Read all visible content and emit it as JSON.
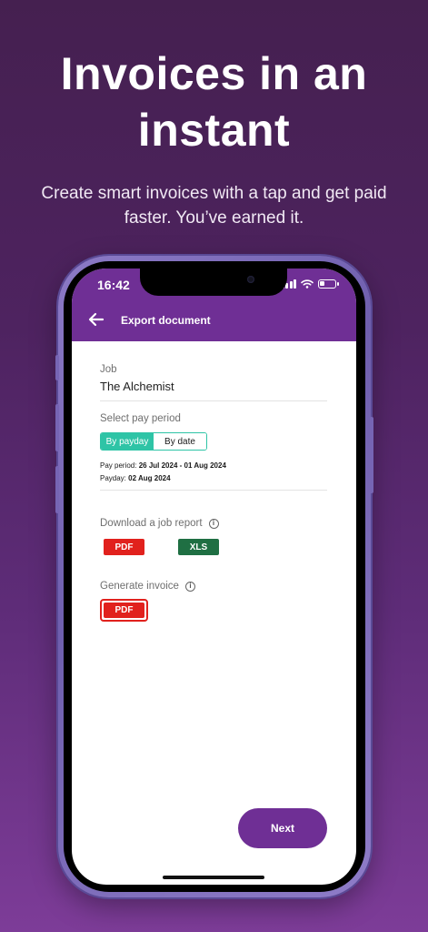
{
  "headline": "Invoices in an instant",
  "subline": "Create smart invoices with a tap and get paid faster. You’ve earned it.",
  "status_bar": {
    "time": "16:42"
  },
  "header": {
    "title": "Export document",
    "back_icon": "arrow-left-icon"
  },
  "job": {
    "label": "Job",
    "value": "The Alchemist"
  },
  "pay_period": {
    "label": "Select pay period",
    "options": [
      "By payday",
      "By date"
    ],
    "selected": "By payday",
    "period_label": "Pay period:",
    "period_value": "26 Jul 2024 - 01 Aug 2024",
    "payday_label": "Payday:",
    "payday_value": "02 Aug 2024"
  },
  "job_report": {
    "label": "Download a job report",
    "pdf": "PDF",
    "xls": "XLS"
  },
  "invoice": {
    "label": "Generate invoice",
    "pdf": "PDF"
  },
  "next_label": "Next",
  "colors": {
    "brand_purple": "#6f2f95",
    "teal": "#2ec4a6",
    "pdf_red": "#e1211d",
    "xls_green": "#1f6f43"
  }
}
